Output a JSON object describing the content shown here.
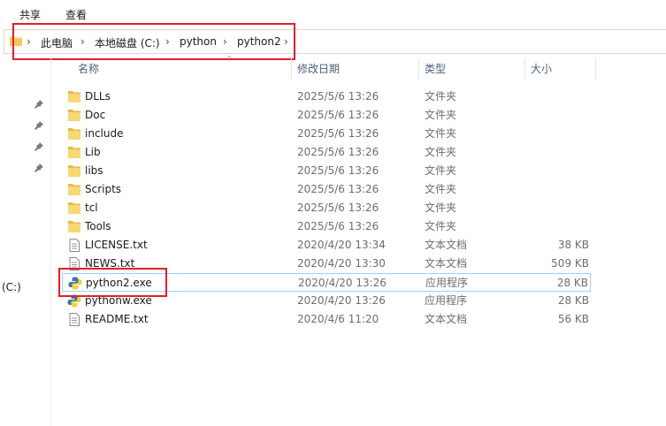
{
  "menu": {
    "share": "共享",
    "view": "查看"
  },
  "breadcrumb": [
    "此电脑",
    "本地磁盘 (C:)",
    "python",
    "python2"
  ],
  "nav": {
    "drive_label": "(C:)"
  },
  "columns": {
    "name": "名称",
    "date": "修改日期",
    "type": "类型",
    "size": "大小"
  },
  "files": [
    {
      "name": "DLLs",
      "date": "2025/5/6 13:26",
      "type": "文件夹",
      "size": "",
      "icon": "folder-icon"
    },
    {
      "name": "Doc",
      "date": "2025/5/6 13:26",
      "type": "文件夹",
      "size": "",
      "icon": "folder-icon"
    },
    {
      "name": "include",
      "date": "2025/5/6 13:26",
      "type": "文件夹",
      "size": "",
      "icon": "folder-icon"
    },
    {
      "name": "Lib",
      "date": "2025/5/6 13:26",
      "type": "文件夹",
      "size": "",
      "icon": "folder-icon"
    },
    {
      "name": "libs",
      "date": "2025/5/6 13:26",
      "type": "文件夹",
      "size": "",
      "icon": "folder-icon"
    },
    {
      "name": "Scripts",
      "date": "2025/5/6 13:26",
      "type": "文件夹",
      "size": "",
      "icon": "folder-icon"
    },
    {
      "name": "tcl",
      "date": "2025/5/6 13:26",
      "type": "文件夹",
      "size": "",
      "icon": "folder-icon"
    },
    {
      "name": "Tools",
      "date": "2025/5/6 13:26",
      "type": "文件夹",
      "size": "",
      "icon": "folder-icon"
    },
    {
      "name": "LICENSE.txt",
      "date": "2020/4/20 13:34",
      "type": "文本文档",
      "size": "38 KB",
      "icon": "text-file-icon"
    },
    {
      "name": "NEWS.txt",
      "date": "2020/4/20 13:30",
      "type": "文本文档",
      "size": "509 KB",
      "icon": "text-file-icon"
    },
    {
      "name": "python2.exe",
      "date": "2020/4/20 13:26",
      "type": "应用程序",
      "size": "28 KB",
      "icon": "python-icon"
    },
    {
      "name": "pythonw.exe",
      "date": "2020/4/20 13:26",
      "type": "应用程序",
      "size": "28 KB",
      "icon": "python-icon"
    },
    {
      "name": "README.txt",
      "date": "2020/4/6 11:20",
      "type": "文本文档",
      "size": "56 KB",
      "icon": "text-file-icon"
    }
  ],
  "colors": {
    "folder": "#f8d775",
    "folder_dark": "#e8b84a",
    "highlight": "#e0202a",
    "selection_border": "#99d1ff",
    "header_text": "#4c607a"
  }
}
